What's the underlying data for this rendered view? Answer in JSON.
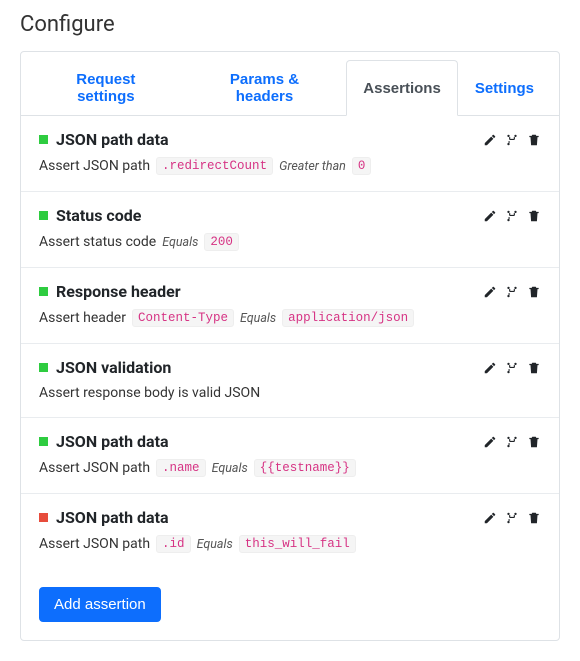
{
  "page_title": "Configure",
  "tabs": [
    {
      "label": "Request settings",
      "active": false
    },
    {
      "label": "Params & headers",
      "active": false
    },
    {
      "label": "Assertions",
      "active": true
    },
    {
      "label": "Settings",
      "active": false
    }
  ],
  "assertions": [
    {
      "status": "green",
      "title": "JSON path data",
      "desc_prefix": "Assert JSON path",
      "path": ".redirectCount",
      "operator": "Greater than",
      "value": "0"
    },
    {
      "status": "green",
      "title": "Status code",
      "desc_prefix": "Assert status code",
      "path": null,
      "operator": "Equals",
      "value": "200"
    },
    {
      "status": "green",
      "title": "Response header",
      "desc_prefix": "Assert header",
      "path": "Content-Type",
      "operator": "Equals",
      "value": "application/json"
    },
    {
      "status": "green",
      "title": "JSON validation",
      "desc_prefix": "Assert response body is valid JSON",
      "path": null,
      "operator": null,
      "value": null
    },
    {
      "status": "green",
      "title": "JSON path data",
      "desc_prefix": "Assert JSON path",
      "path": ".name",
      "operator": "Equals",
      "value": "{{testname}}"
    },
    {
      "status": "red",
      "title": "JSON path data",
      "desc_prefix": "Assert JSON path",
      "path": ".id",
      "operator": "Equals",
      "value": "this_will_fail"
    }
  ],
  "add_button_label": "Add assertion",
  "icons": {
    "edit": "edit-icon",
    "fork": "fork-icon",
    "delete": "trash-icon"
  }
}
